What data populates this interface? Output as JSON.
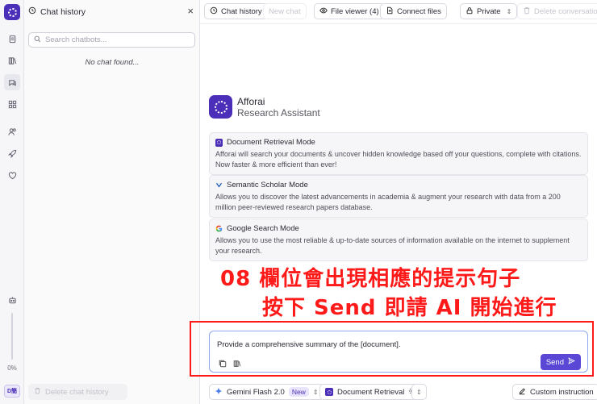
{
  "history_panel": {
    "title": "Chat history",
    "search_placeholder": "Search chatbots...",
    "empty_text": "No chat found...",
    "delete_label": "Delete chat history"
  },
  "rail": {
    "zoom_percent": "0%",
    "language_label": "D簡"
  },
  "toolbar": {
    "chat_history": "Chat history",
    "new_chat": "New chat",
    "file_viewer": "File viewer (4)",
    "connect_files": "Connect files",
    "privacy": "Private",
    "delete_conversation": "Delete conversation"
  },
  "brand": {
    "name": "Afforai",
    "subtitle": "Research Assistant"
  },
  "modes": [
    {
      "title": "Document Retrieval Mode",
      "icon": "afforai-logo-icon",
      "description": "Afforai will search your documents & uncover hidden knowledge based off your questions, complete with citations. Now faster & more efficient than ever!"
    },
    {
      "title": "Semantic Scholar Mode",
      "icon": "semantic-scholar-icon",
      "description": "Allows you to discover the latest advancements in academia & augment your research with data from a 200 million peer-reviewed research papers database."
    },
    {
      "title": "Google Search Mode",
      "icon": "google-icon",
      "description": "Allows you to use the most reliable & up-to-date sources of information available on the internet to supplement your research."
    }
  ],
  "annotation": {
    "line1": "08 欄位會出現相應的提示句子",
    "line2": "按下 Send 即請 AI 開始進行"
  },
  "prompt": {
    "value": "Provide a comprehensive summary of the [document].",
    "send_label": "Send"
  },
  "bottom": {
    "model": "Gemini Flash 2.0",
    "model_badge": "New",
    "retrieval": "Document Retrieval",
    "custom_instruction": "Custom instruction"
  },
  "colors": {
    "brand": "#4b2fb8",
    "send": "#5b47d6",
    "annotation": "#ff1a1a"
  }
}
